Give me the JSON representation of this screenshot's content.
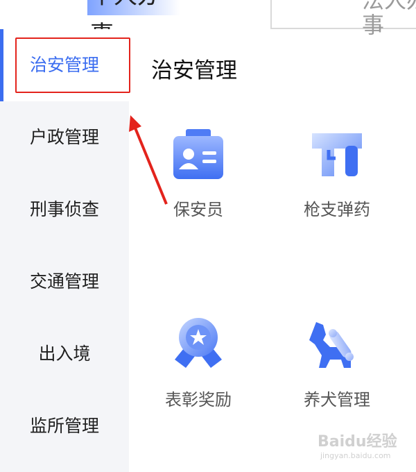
{
  "tabs": {
    "personal": "个人办事",
    "legal": "法人办事"
  },
  "sidebar": {
    "items": [
      {
        "label": "治安管理",
        "active": true
      },
      {
        "label": "户政管理",
        "active": false
      },
      {
        "label": "刑事侦查",
        "active": false
      },
      {
        "label": "交通管理",
        "active": false
      },
      {
        "label": "出入境",
        "active": false
      },
      {
        "label": "监所管理",
        "active": false
      }
    ]
  },
  "main": {
    "title": "治安管理",
    "tiles": [
      {
        "label": "保安员",
        "icon": "security-guard-id-card-icon"
      },
      {
        "label": "枪支弹药",
        "icon": "firearms-gun-icon"
      },
      {
        "label": "表彰奖励",
        "icon": "award-medal-icon"
      },
      {
        "label": "养犬管理",
        "icon": "dog-bone-icon"
      }
    ]
  },
  "annotation": {
    "highlight_color": "#e3231c"
  },
  "watermark": {
    "text": "Baidu经验",
    "url": "jingyan.baidu.com"
  },
  "colors": {
    "accent": "#3b6df0",
    "sidebar_bg": "#f4f5f8"
  }
}
